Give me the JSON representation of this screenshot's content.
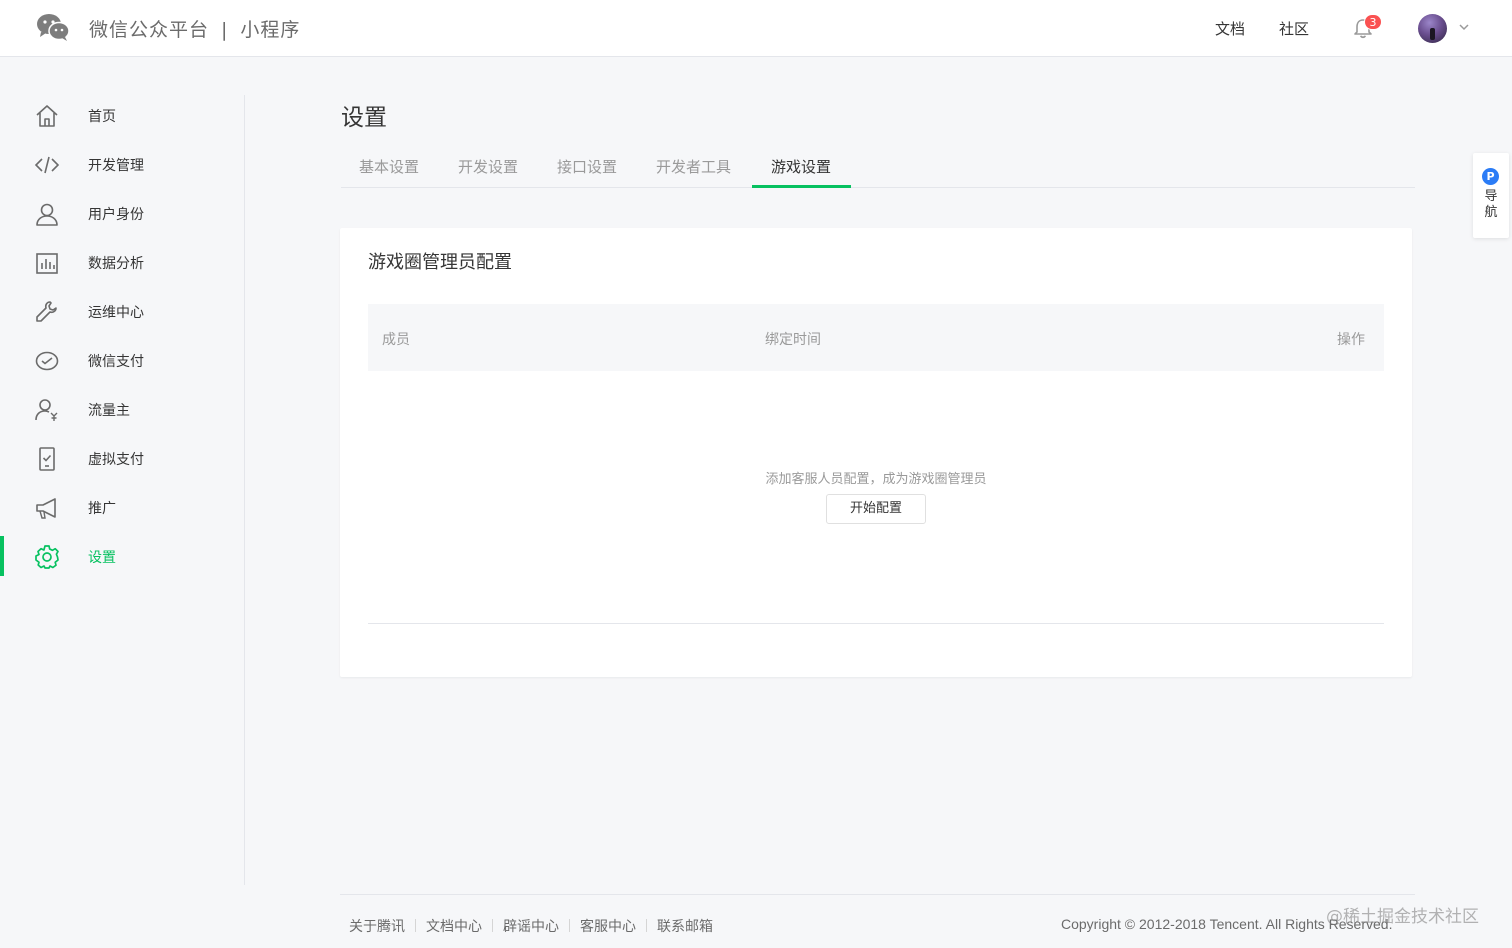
{
  "header": {
    "brand": "微信公众平台",
    "brand_sep": "|",
    "product": "小程序",
    "links": [
      "文档",
      "社区"
    ],
    "notifications_count": "3"
  },
  "sidebar": {
    "items": [
      {
        "label": "首页",
        "icon": "home-icon"
      },
      {
        "label": "开发管理",
        "icon": "code-icon"
      },
      {
        "label": "用户身份",
        "icon": "user-icon"
      },
      {
        "label": "数据分析",
        "icon": "chart-icon"
      },
      {
        "label": "运维中心",
        "icon": "wrench-icon"
      },
      {
        "label": "微信支付",
        "icon": "wechat-pay-icon"
      },
      {
        "label": "流量主",
        "icon": "traffic-icon"
      },
      {
        "label": "虚拟支付",
        "icon": "virtual-pay-icon"
      },
      {
        "label": "推广",
        "icon": "megaphone-icon"
      },
      {
        "label": "设置",
        "icon": "gear-icon",
        "active": true
      }
    ]
  },
  "main": {
    "title": "设置",
    "tabs": [
      {
        "label": "基本设置"
      },
      {
        "label": "开发设置"
      },
      {
        "label": "接口设置"
      },
      {
        "label": "开发者工具"
      },
      {
        "label": "游戏设置",
        "active": true
      }
    ],
    "card": {
      "title": "游戏圈管理员配置",
      "columns": [
        "成员",
        "绑定时间",
        "操作"
      ],
      "empty_text": "添加客服人员配置，成为游戏圈管理员",
      "button": "开始配置"
    }
  },
  "float_nav": {
    "badge": "P",
    "label": "导航"
  },
  "footer": {
    "links": [
      "关于腾讯",
      "文档中心",
      "辟谣中心",
      "客服中心",
      "联系邮箱"
    ],
    "copyright": "Copyright © 2012-2018 Tencent. All Rights Reserved."
  },
  "watermark": "@稀土掘金技术社区",
  "colors": {
    "accent": "#07c160",
    "badge": "#fa5151",
    "float_p": "#2b7cf6"
  }
}
